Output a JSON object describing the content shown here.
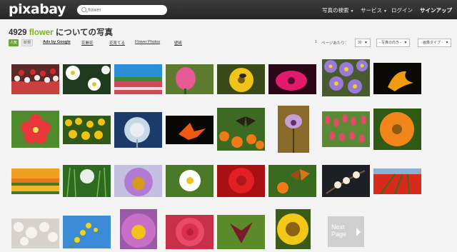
{
  "header": {
    "logo": "pixabay",
    "search_placeholder": "flower",
    "nav": [
      "写真の検索",
      "サービス",
      "ログイン",
      "サインアップ"
    ]
  },
  "results": {
    "count": "4929",
    "keyword": "flower",
    "suffix": "についての写真"
  },
  "filters": {
    "tabs": [
      "人気",
      "新規"
    ],
    "links": [
      "Ads by Google",
      "花開花",
      "花育てる",
      "Flower Photos",
      "壁紙"
    ]
  },
  "pager": {
    "page": "1",
    "per_page_label": "ページあたり：",
    "per_page": "30",
    "orientation": "- 写真の向き -",
    "type": "- 画像タイプ -"
  },
  "next_page": [
    "Next",
    "Page"
  ],
  "photos": [
    "red-white-tulip-field",
    "white-daisies",
    "tulip-field-blue-sky",
    "pink-tulip",
    "bee-on-yellow-flower",
    "pink-gerbera",
    "purple-aster-cluster",
    "orange-flower-dark",
    "red-hibiscus",
    "yellow-flower-meadow",
    "dandelion-seed-head",
    "orange-lily",
    "butterfly-on-flowers",
    "purple-orchid",
    "tulip-bed",
    "orange-gerbera",
    "orange-tulip-field",
    "dandelion-grass",
    "purple-echinacea",
    "white-daisy",
    "red-flower-closeup",
    "butterfly-orange-flower",
    "white-blossom-branch",
    "red-tulip-rows",
    "white-cherry-blossom",
    "yellow-flowers-sky",
    "pink-flower-yellow-center",
    "pink-rose",
    "dark-red-lily",
    "yellow-sunflower"
  ],
  "colors": {
    "brand_green": "#7ab51d",
    "topbar": "#2f2f2f"
  }
}
